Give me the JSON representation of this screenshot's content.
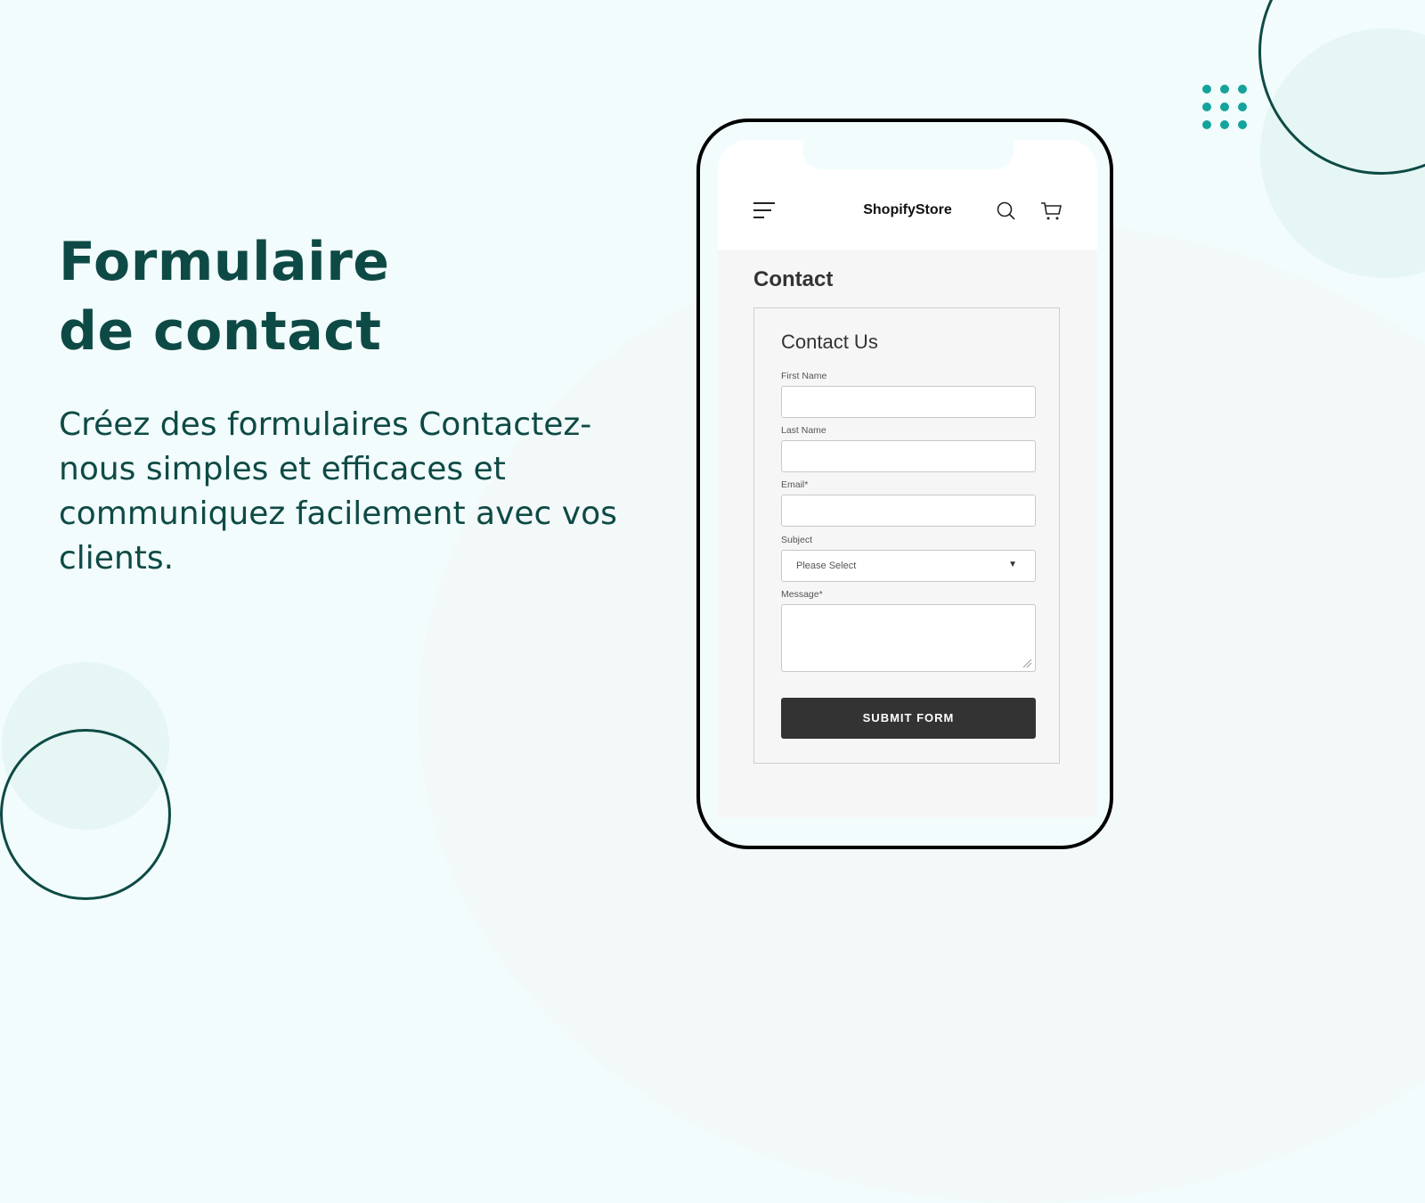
{
  "hero": {
    "title_line1": "Formulaire",
    "title_line2": "de contact",
    "description": "Créez des formulaires Contactez-nous simples et efficaces et communiquez facilement avec vos clients."
  },
  "colors": {
    "brand_dark": "#0e4a45",
    "accent_teal": "#14a39a",
    "background": "#f2fcfc",
    "button_dark": "#333333"
  },
  "phone": {
    "store": {
      "name": "ShopifyStore",
      "icons": [
        "menu-icon",
        "search-icon",
        "cart-icon"
      ]
    },
    "page_title": "Contact",
    "form": {
      "title": "Contact Us",
      "fields": [
        {
          "label": "First Name",
          "value": "",
          "type": "text"
        },
        {
          "label": "Last Name",
          "value": "",
          "type": "text"
        },
        {
          "label": "Email*",
          "value": "",
          "type": "email"
        },
        {
          "label": "Subject",
          "value": "Please Select",
          "type": "select"
        },
        {
          "label": "Message*",
          "value": "",
          "type": "textarea"
        }
      ],
      "submit_label": "SUBMIT FORM"
    }
  }
}
